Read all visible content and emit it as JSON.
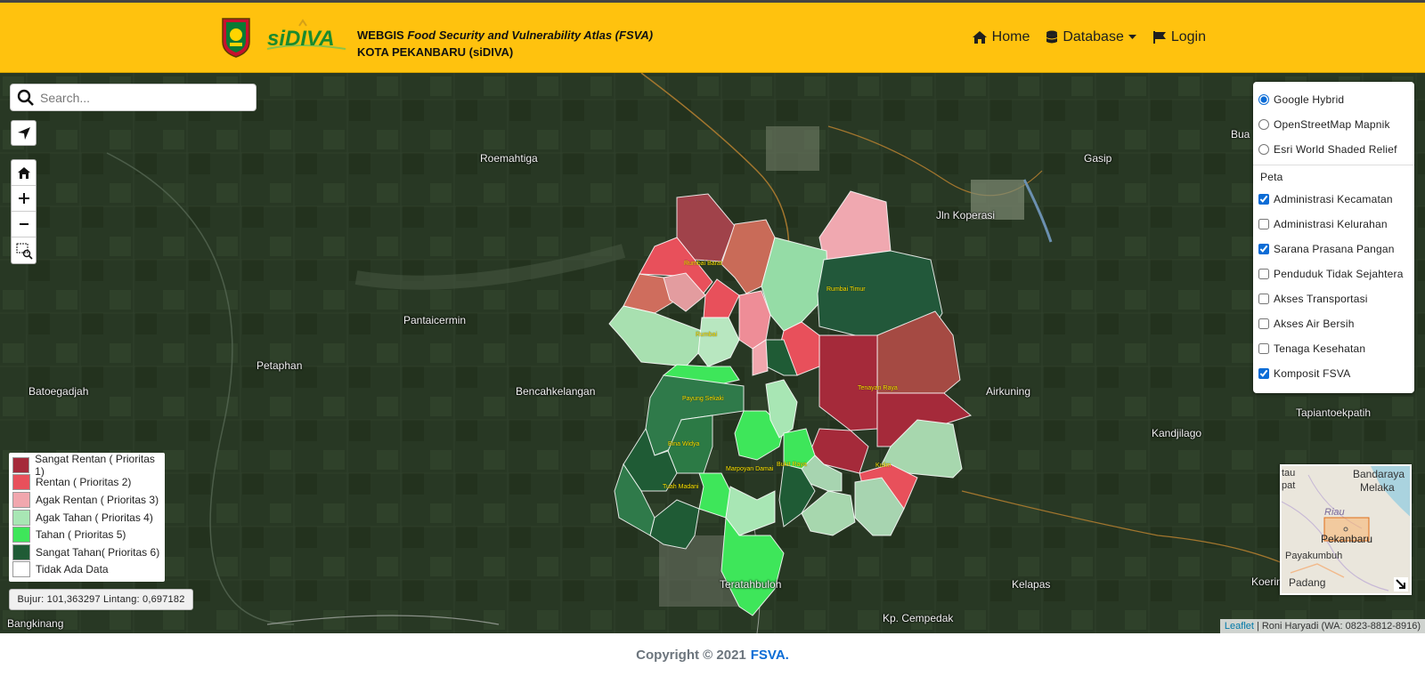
{
  "header": {
    "title_prefix": "WEBGIS",
    "title_italic": "Food Security and Vulnerability Atlas (FSVA)",
    "subtitle": "KOTA PEKANBARU (siDIVA)",
    "brand_logo_text": "siDIVA",
    "nav": {
      "home": "Home",
      "database": "Database",
      "login": "Login"
    }
  },
  "search": {
    "placeholder": "Search..."
  },
  "map": {
    "places": [
      "Roemahtiga",
      "Gasip",
      "Jln Koperasi",
      "Pantaicermin",
      "Petaphan",
      "Batoegadjah",
      "Bencahkelangan",
      "Airkuning",
      "Tapiantoekpatih",
      "Kandjilago",
      "Teratahbuloh",
      "Kelapas",
      "Bangkinang",
      "Kp. Cempedak",
      "Bua",
      "Koerin"
    ],
    "kecamatan": [
      "Rumbai Barat",
      "Rumbai Timur",
      "Rumbai",
      "Payung Sekaki",
      "Bina Widya",
      "Tenayan Raya",
      "Tuah Madani",
      "Marpoyan Damai",
      "Bukit Raya",
      "Kulim"
    ]
  },
  "layers": {
    "base": [
      {
        "label": "Google Hybrid",
        "checked": true
      },
      {
        "label": "OpenStreetMap Mapnik",
        "checked": false
      },
      {
        "label": "Esri World Shaded Relief",
        "checked": false
      }
    ],
    "overlay_title": "Peta",
    "overlays": [
      {
        "label": "Administrasi Kecamatan",
        "checked": true
      },
      {
        "label": "Administrasi Kelurahan",
        "checked": false
      },
      {
        "label": "Sarana Prasana Pangan",
        "checked": true
      },
      {
        "label": "Penduduk Tidak Sejahtera",
        "checked": false
      },
      {
        "label": "Akses Transportasi",
        "checked": false
      },
      {
        "label": "Akses Air Bersih",
        "checked": false
      },
      {
        "label": "Tenaga Kesehatan",
        "checked": false
      },
      {
        "label": "Komposit FSVA",
        "checked": true
      }
    ]
  },
  "legend": [
    {
      "label": "Sangat Rentan ( Prioritas 1)",
      "color": "#a52a3a"
    },
    {
      "label": "Rentan ( Prioritas 2)",
      "color": "#e8505b"
    },
    {
      "label": "Agak Rentan ( Prioritas 3)",
      "color": "#f1a7ae"
    },
    {
      "label": "Agak Tahan ( Prioritas 4)",
      "color": "#a8e6b4"
    },
    {
      "label": "Tahan ( Prioritas 5)",
      "color": "#3ee65a"
    },
    {
      "label": "Sangat  Tahan( Prioritas 6)",
      "color": "#1f5b35"
    },
    {
      "label": "Tidak Ada Data",
      "color": "#ffffff"
    }
  ],
  "coordinates": "Bujur: 101,363297 Lintang: 0,697182",
  "minimap": {
    "labels": [
      "Bandaraya",
      "Melaka",
      "tau",
      "pat",
      "Riau",
      "Pekanbaru",
      "Payakumbuh",
      "Padang"
    ]
  },
  "attribution": {
    "link": "Leaflet",
    "text": "| Roni Haryadi (WA: 0823-8812-8916)"
  },
  "footer": {
    "text": "Copyright © 2021",
    "link": "FSVA."
  }
}
